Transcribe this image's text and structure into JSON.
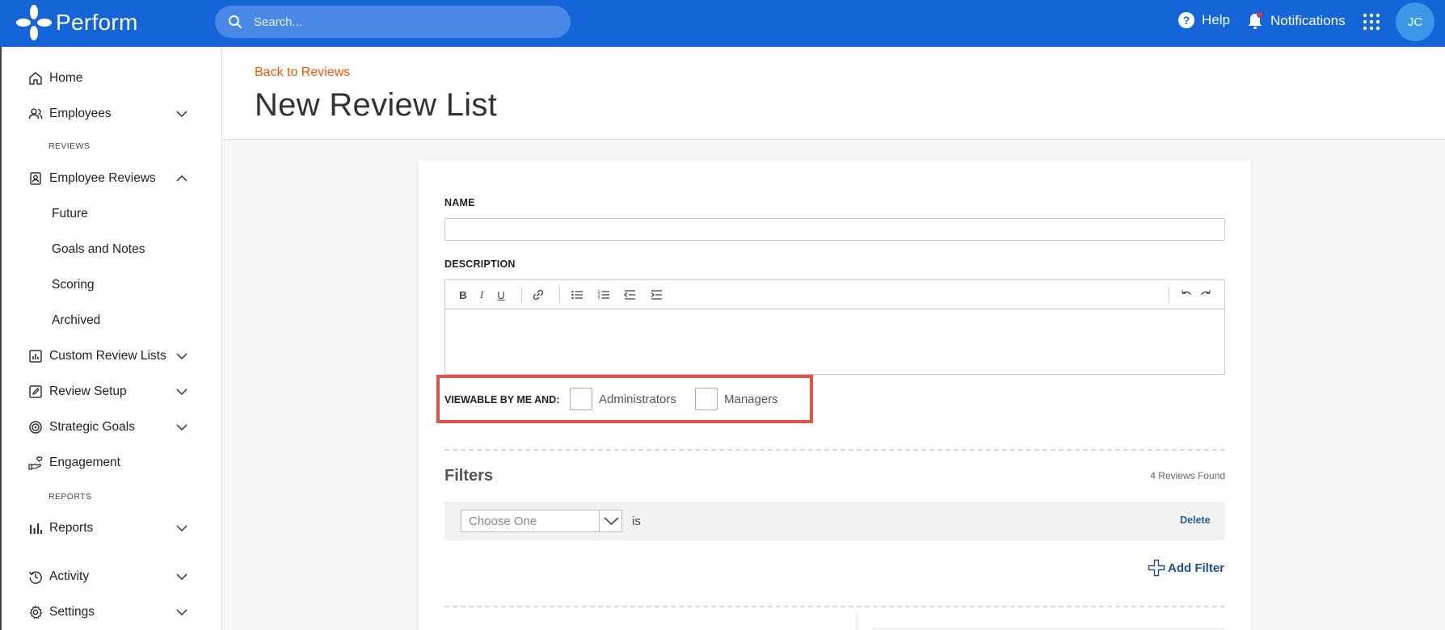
{
  "app": {
    "name": "Perform",
    "search_placeholder": "Search...",
    "help_label": "Help",
    "notifications_label": "Notifications",
    "avatar_initials": "JC",
    "brand_color": "#1565d8"
  },
  "sidebar": {
    "home": "Home",
    "employees": "Employees",
    "section_reviews": "REVIEWS",
    "employee_reviews": "Employee Reviews",
    "sub_items": [
      "Future",
      "Goals and Notes",
      "Scoring",
      "Archived"
    ],
    "custom_review_lists": "Custom Review Lists",
    "review_setup": "Review Setup",
    "strategic_goals": "Strategic Goals",
    "engagement": "Engagement",
    "section_reports": "REPORTS",
    "reports": "Reports",
    "activity": "Activity",
    "settings": "Settings"
  },
  "header": {
    "back_link": "Back to Reviews",
    "title": "New Review List"
  },
  "form": {
    "name_label": "NAME",
    "name_value": "",
    "description_label": "DESCRIPTION",
    "viewable_label": "VIEWABLE BY ME AND:",
    "administrators_label": "Administrators",
    "administrators_checked": false,
    "managers_label": "Managers",
    "managers_checked": false,
    "highlight_color": "#e0514a"
  },
  "filters": {
    "title": "Filters",
    "count_text": "4 Reviews Found",
    "select_placeholder": "Choose One",
    "operator": "is",
    "delete_label": "Delete",
    "add_filter_label": "Add Filter"
  }
}
